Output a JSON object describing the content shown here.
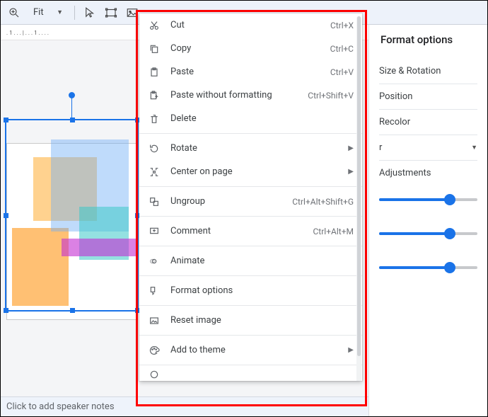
{
  "toolbar": {
    "zoom_value": "Fit"
  },
  "ruler": {
    "ticks": ". 1 . . . | . . . 1 . . . ."
  },
  "panel": {
    "title": "Format options",
    "sections": {
      "size_rotation": "Size & Rotation",
      "position": "Position",
      "recolor": "Recolor",
      "unknown_r": "r",
      "adjustments": "Adjustments"
    },
    "sliders": {
      "a": 72,
      "b": 72,
      "c": 72
    }
  },
  "speaker_notes_placeholder": "Click to add speaker notes",
  "context_menu": {
    "cut": {
      "label": "Cut",
      "shortcut": "Ctrl+X"
    },
    "copy": {
      "label": "Copy",
      "shortcut": "Ctrl+C"
    },
    "paste": {
      "label": "Paste",
      "shortcut": "Ctrl+V"
    },
    "paste_plain": {
      "label": "Paste without formatting",
      "shortcut": "Ctrl+Shift+V"
    },
    "delete": {
      "label": "Delete",
      "shortcut": ""
    },
    "rotate": {
      "label": "Rotate",
      "submenu": true
    },
    "center": {
      "label": "Center on page",
      "submenu": true
    },
    "ungroup": {
      "label": "Ungroup",
      "shortcut": "Ctrl+Alt+Shift+G"
    },
    "comment": {
      "label": "Comment",
      "shortcut": "Ctrl+Alt+M"
    },
    "animate": {
      "label": "Animate",
      "shortcut": ""
    },
    "format_options": {
      "label": "Format options",
      "shortcut": ""
    },
    "reset_image": {
      "label": "Reset image",
      "shortcut": ""
    },
    "add_to_theme": {
      "label": "Add to theme",
      "submenu": true
    }
  }
}
